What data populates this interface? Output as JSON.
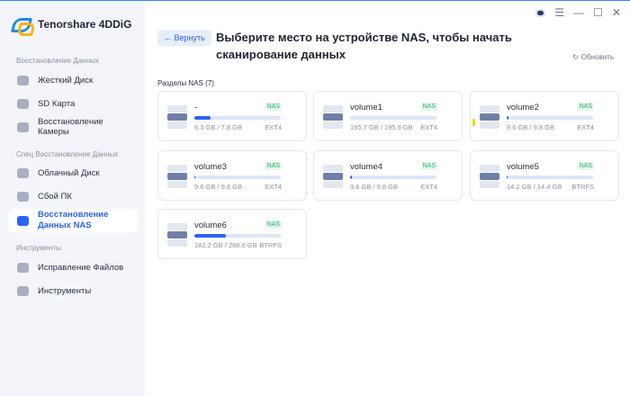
{
  "app": {
    "title": "Tenorshare 4DDiG"
  },
  "sidebar": {
    "sections": [
      {
        "label": "Восстановление Данных"
      },
      {
        "label": "Спец Восстановление Данных"
      },
      {
        "label": "Инструменты"
      }
    ],
    "items": [
      {
        "label": "Жесткий Диск",
        "icon": "hard-disk-icon"
      },
      {
        "label": "SD Карта",
        "icon": "sd-card-icon"
      },
      {
        "label": "Восстановление Камеры",
        "icon": "camera-icon"
      },
      {
        "label": "Облачный Диск",
        "icon": "cloud-icon"
      },
      {
        "label": "Сбой ПК",
        "icon": "pc-crash-icon"
      },
      {
        "label": "Восстановление Данных NAS",
        "icon": "nas-icon",
        "active": true
      },
      {
        "label": "Исправление Файлов",
        "icon": "file-repair-icon"
      },
      {
        "label": "Инструменты",
        "icon": "toolbox-icon"
      }
    ]
  },
  "header": {
    "back_label": "← Вернуть",
    "title": "Выберите место на устройстве NAS, чтобы начать сканирование данных",
    "refresh_label": "Обновить"
  },
  "partitions": {
    "label": "Разделы NAS (7)",
    "items": [
      {
        "name": "-",
        "badge": "NAS",
        "size": "6.3 GB / 7.8 GB",
        "fs": "EXT4",
        "progress": 0.19
      },
      {
        "name": "volume1",
        "badge": "NAS",
        "size": "195.7 GB / 195.9 GB",
        "fs": "EXT4",
        "progress": 0
      },
      {
        "name": "volume2",
        "badge": "NAS",
        "size": "9.6 GB / 9.8 GB",
        "fs": "EXT4",
        "progress": 0.02,
        "warning": true
      },
      {
        "name": "volume3",
        "badge": "NAS",
        "size": "9.6 GB / 9.8 GB",
        "fs": "EXT4",
        "progress": 0.01
      },
      {
        "name": "volume4",
        "badge": "NAS",
        "size": "9.6 GB / 9.8 GB",
        "fs": "EXT4",
        "progress": 0.02
      },
      {
        "name": "volume5",
        "badge": "NAS",
        "size": "14.2 GB / 14.4 GB",
        "fs": "BTRFS",
        "progress": 0.01
      },
      {
        "name": "volume6",
        "badge": "NAS",
        "size": "182.2 GB / 288.0 GB",
        "fs": "BTRFS",
        "progress": 0.36
      }
    ]
  },
  "colors": {
    "accent": "#2a63f5",
    "badge": "#2fb36a",
    "sidebar_bg": "#f3f5fa"
  }
}
